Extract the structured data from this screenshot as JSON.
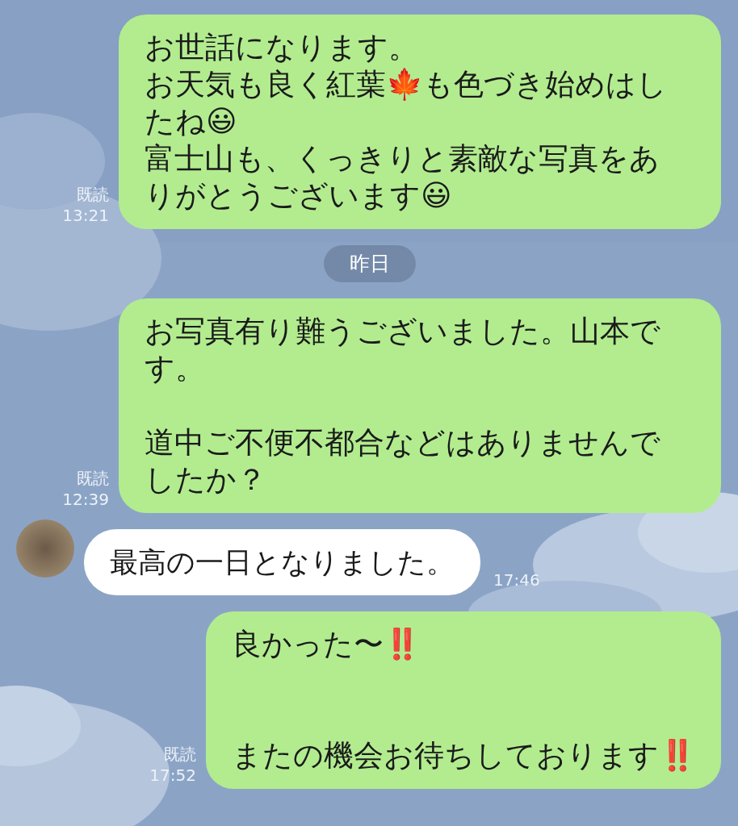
{
  "messages": [
    {
      "kind": "outgoing",
      "paragraphs": [
        {
          "text": "お世話になります。",
          "kind": "line"
        },
        {
          "text": "お天気も良く紅葉🍁も色づき始めはしたね😃",
          "kind": "line"
        },
        {
          "text": "富士山も、くっきりと素敵な写真をありがとうございます😃",
          "kind": "line"
        }
      ],
      "read": "既読",
      "time": "13:21"
    },
    {
      "kind": "date",
      "text": "昨日"
    },
    {
      "kind": "outgoing",
      "paragraphs": [
        {
          "text": "お写真有り難うございました。山本です。",
          "kind": "line"
        },
        {
          "text": "道中ご不便不都合などはありませんでしたか？",
          "kind": "spaced"
        }
      ],
      "read": "既読",
      "time": "12:39"
    },
    {
      "kind": "incoming",
      "text": "最高の一日となりました。",
      "time": "17:46"
    },
    {
      "kind": "outgoing",
      "paragraphs": [
        {
          "text": "良かった〜‼️",
          "kind": "line"
        },
        {
          "text": "またの機会お待ちしております‼️",
          "kind": "gapped"
        }
      ],
      "read": "既読",
      "time": "17:52"
    }
  ]
}
